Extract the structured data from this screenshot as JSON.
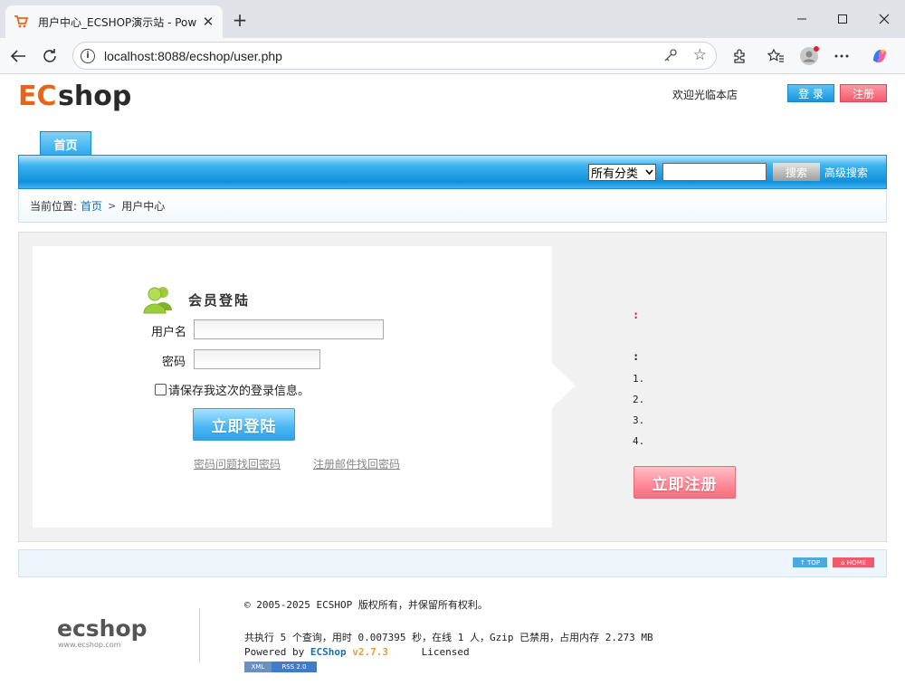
{
  "browser": {
    "tab_title": "用户中心_ECSHOP演示站 - Powered",
    "url": "localhost:8088/ecshop/user.php",
    "new_tab_label": "+",
    "close_tab": "✕"
  },
  "header": {
    "welcome": "欢迎光临本店",
    "login_label": "登 录",
    "register_label": "注册"
  },
  "nav": {
    "home_tab": "首页",
    "category_select": "所有分类",
    "search_button": "搜索",
    "advanced_search": "高级搜索"
  },
  "breadcrumb": {
    "prefix": "当前位置:",
    "home": "首页",
    "separator": ">",
    "current": "用户中心"
  },
  "login": {
    "title": "会员登陆",
    "username_label": "用户名",
    "password_label": "密码",
    "remember_label": "请保存我这次的登录信息。",
    "submit_label": "立即登陆",
    "forgot_by_question": "密码问题找回密码",
    "forgot_by_email": "注册邮件找回密码"
  },
  "register_info": {
    "colon_red": ":",
    "colon_black": ":",
    "items": [
      "1.",
      "2.",
      "3.",
      "4."
    ],
    "register_now_label": "立即注册"
  },
  "footer": {
    "top_badge": "↑ TOP",
    "home_badge": "⌂ HOME",
    "copyright": "© 2005-2025 ECSHOP 版权所有，并保留所有权利。",
    "stats": "共执行 5 个查询，用时 0.007395 秒，在线 1 人，Gzip 已禁用，占用内存 2.273 MB",
    "powered_by_prefix": "Powered by",
    "powered_by_name": "ECShop",
    "version": "v2.7.3",
    "license": "Licensed",
    "xml_badge": "XML",
    "rss_badge": "RSS 2.0",
    "logo_url_text": "www.ecshop.com"
  },
  "colors": {
    "nav_blue": "#108fdc",
    "login_blue": "#1796de",
    "register_pink": "#f25a6c",
    "link_blue": "#1a6fae"
  }
}
